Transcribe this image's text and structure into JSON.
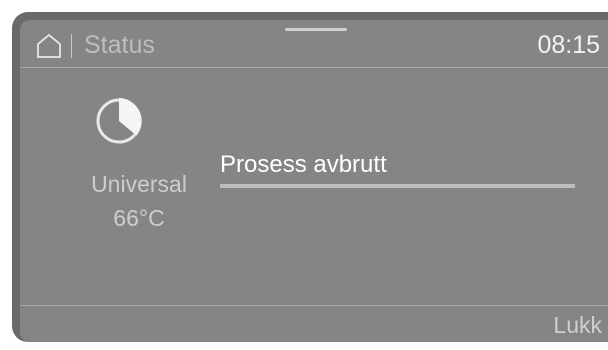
{
  "header": {
    "title": "Status",
    "time": "08:15",
    "home_icon": "home-icon"
  },
  "program": {
    "icon": "pie-progress-icon",
    "name": "Universal",
    "temperature": "66°C"
  },
  "status": {
    "message": "Prosess avbrutt",
    "progress": 1.0
  },
  "footer": {
    "close_label": "Lukk"
  },
  "colors": {
    "screen_bg": "#858585",
    "bezel": "#6a6a6a",
    "text_primary": "#ffffff",
    "text_muted": "#cdcdcd"
  }
}
